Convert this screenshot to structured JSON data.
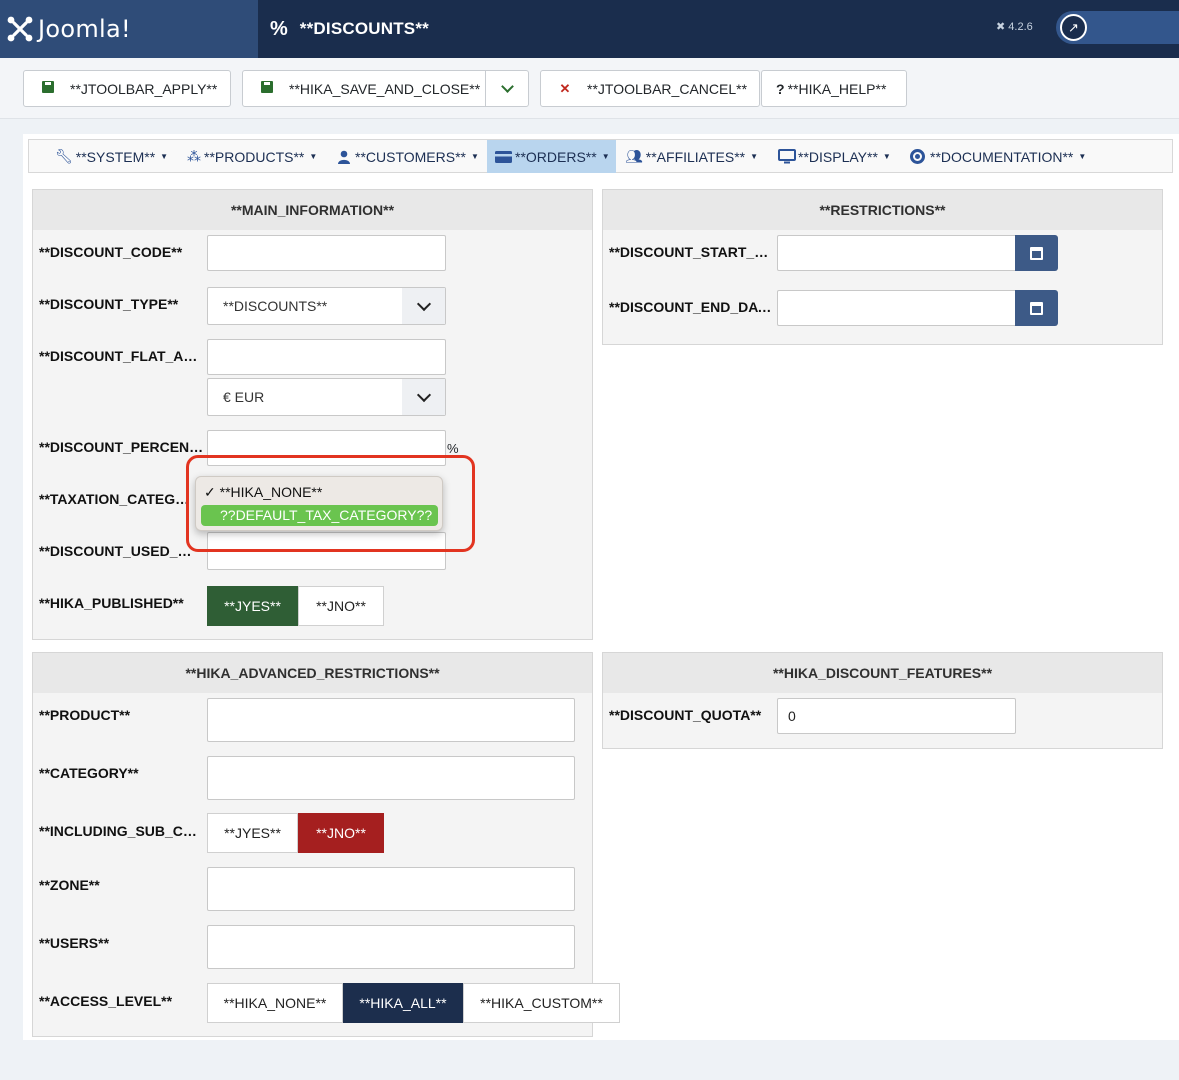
{
  "header": {
    "brand": "Joomla!",
    "page_title": "**DISCOUNTS**",
    "version": "4.2.6"
  },
  "toolbar": {
    "apply": "**JTOOLBAR_APPLY**",
    "save_close": "**HIKA_SAVE_AND_CLOSE**",
    "cancel": "**JTOOLBAR_CANCEL**",
    "help": "**HIKA_HELP**"
  },
  "menu": {
    "items": [
      {
        "label": "**SYSTEM**",
        "icon": "wrench-icon"
      },
      {
        "label": "**PRODUCTS**",
        "icon": "cubes-icon"
      },
      {
        "label": "**CUSTOMERS**",
        "icon": "user-icon"
      },
      {
        "label": "**ORDERS**",
        "icon": "credit-card-icon"
      },
      {
        "label": "**AFFILIATES**",
        "icon": "users-icon"
      },
      {
        "label": "**DISPLAY**",
        "icon": "monitor-icon"
      },
      {
        "label": "**DOCUMENTATION**",
        "icon": "lifebuoy-icon"
      }
    ],
    "active": "**ORDERS**"
  },
  "main_info": {
    "title": "**MAIN_INFORMATION**",
    "code_label": "**DISCOUNT_CODE**",
    "code_value": "",
    "type_label": "**DISCOUNT_TYPE**",
    "type_value": "**DISCOUNTS**",
    "flat_label": "**DISCOUNT_FLAT_AMOUNT**",
    "flat_value": "",
    "currency_value": "€ EUR",
    "percent_label": "**DISCOUNT_PERCENT_AMOUNT**",
    "percent_value": "",
    "percent_unit": "%",
    "tax_label": "**TAXATION_CATEGORY**",
    "used_label": "**DISCOUNT_USED_TIMES**",
    "used_value": "",
    "published_label": "**HIKA_PUBLISHED**",
    "yes": "**JYES**",
    "no": "**JNO**"
  },
  "tax_dropdown": {
    "selected_option": "✓ **HIKA_NONE**",
    "highlighted_option": "??DEFAULT_TAX_CATEGORY??"
  },
  "restrictions": {
    "title": "**RESTRICTIONS**",
    "start_label": "**DISCOUNT_START_DATE**",
    "start_value": "",
    "end_label": "**DISCOUNT_END_DATE**",
    "end_value": ""
  },
  "advanced": {
    "title": "**HIKA_ADVANCED_RESTRICTIONS**",
    "product_label": "**PRODUCT**",
    "category_label": "**CATEGORY**",
    "subcat_label": "**INCLUDING_SUB_CATEGORIES**",
    "yes": "**JYES**",
    "no": "**JNO**",
    "zone_label": "**ZONE**",
    "users_label": "**USERS**",
    "access_label": "**ACCESS_LEVEL**",
    "access_none": "**HIKA_NONE**",
    "access_all": "**HIKA_ALL**",
    "access_custom": "**HIKA_CUSTOM**"
  },
  "features": {
    "title": "**HIKA_DISCOUNT_FEATURES**",
    "quota_label": "**DISCOUNT_QUOTA**",
    "quota_value": "0"
  },
  "colors": {
    "header": "#1a2d4d",
    "brand": "#2f4c78",
    "published_yes": "#2f5e35",
    "subcat_no": "#a51f1f",
    "access_all": "#1c2e4d",
    "dropdown_highlight": "#6ac44f",
    "annotation": "#e23420"
  }
}
